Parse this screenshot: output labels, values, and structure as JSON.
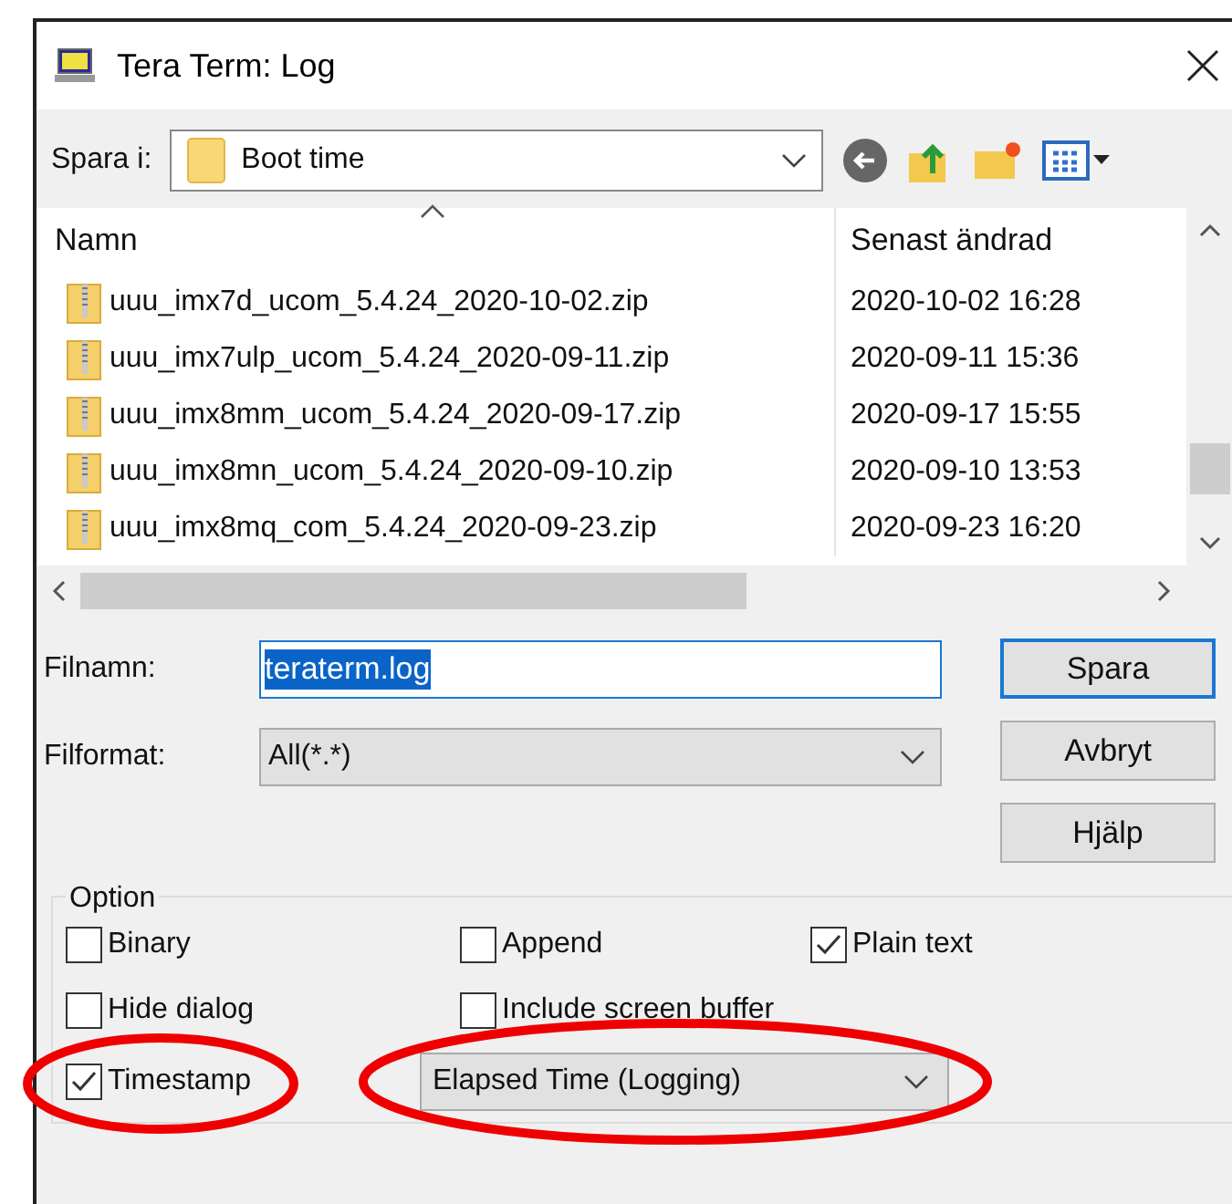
{
  "window": {
    "title": "Tera Term: Log"
  },
  "location": {
    "label": "Spara i:",
    "value": "Boot time"
  },
  "file_list": {
    "columns": [
      "Namn",
      "Senast ändrad"
    ],
    "rows": [
      {
        "name": "uuu_imx7d_ucom_5.4.24_2020-10-02.zip",
        "modified": "2020-10-02 16:28"
      },
      {
        "name": "uuu_imx7ulp_ucom_5.4.24_2020-09-11.zip",
        "modified": "2020-09-11 15:36"
      },
      {
        "name": "uuu_imx8mm_ucom_5.4.24_2020-09-17.zip",
        "modified": "2020-09-17 15:55"
      },
      {
        "name": "uuu_imx8mn_ucom_5.4.24_2020-09-10.zip",
        "modified": "2020-09-10 13:53"
      },
      {
        "name": "uuu_imx8mq_com_5.4.24_2020-09-23.zip",
        "modified": "2020-09-23 16:20"
      }
    ]
  },
  "filename": {
    "label": "Filnamn:",
    "value": "teraterm.log"
  },
  "format": {
    "label": "Filformat:",
    "value": "All(*.*)"
  },
  "buttons": [
    "Spara",
    "Avbryt",
    "Hjälp"
  ],
  "options": {
    "title": "Option",
    "items": [
      {
        "label": "Binary",
        "checked": false,
        "highlight": false
      },
      {
        "label": "Append",
        "checked": false,
        "highlight": false
      },
      {
        "label": "Plain text",
        "checked": true,
        "highlight": false
      },
      {
        "label": "Hide dialog",
        "checked": false,
        "highlight": false
      },
      {
        "label": "Include screen buffer",
        "checked": false,
        "highlight": false
      },
      {
        "label": "Timestamp",
        "checked": true,
        "highlight": true
      }
    ],
    "timestamp_format": {
      "value": "Elapsed Time (Logging)",
      "highlight": true
    }
  }
}
